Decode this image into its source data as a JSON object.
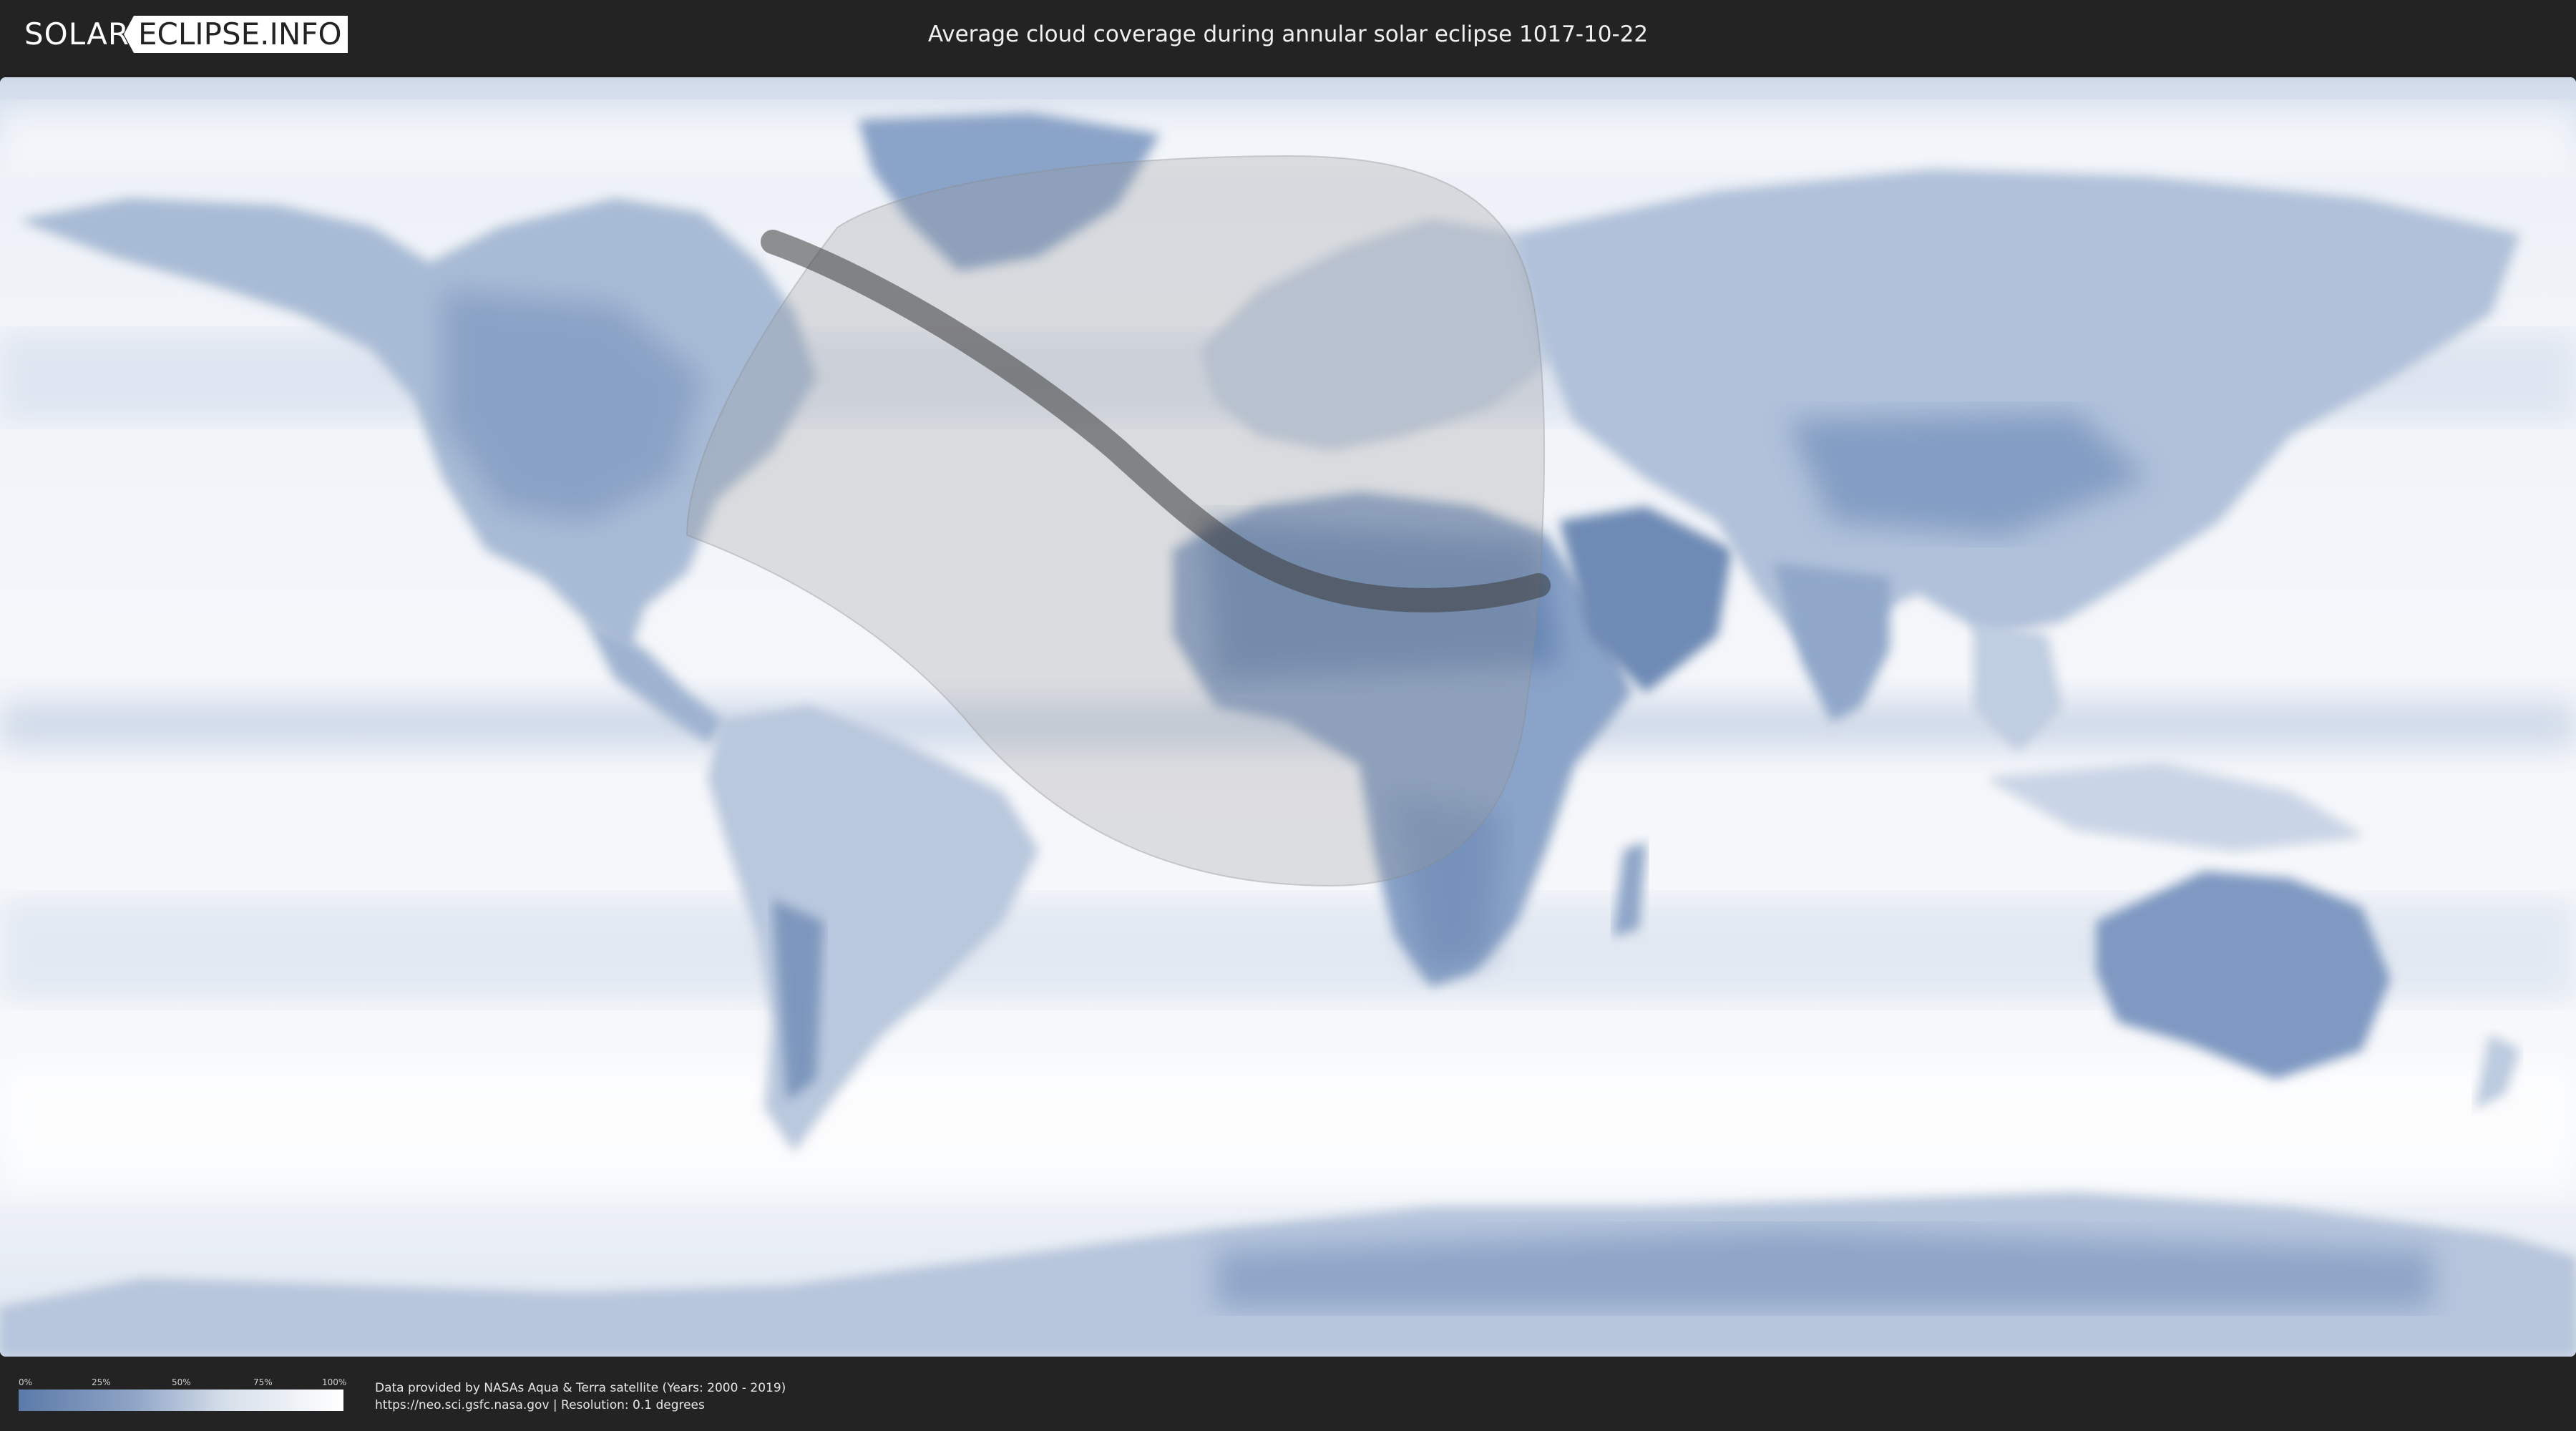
{
  "header": {
    "logo_left": "SOLAR",
    "logo_right": "ECLIPSE.INFO",
    "title": "Average cloud coverage during annular solar eclipse 1017-10-22"
  },
  "map": {
    "description_layer": "cloud-coverage",
    "ocean_color": "#eef2f8",
    "cloud_dense_color": "#ffffff",
    "clear_sky_color": "#5b7aa8",
    "penumbra_color": "#8a8a8a",
    "path_color": "#3a3a3a"
  },
  "legend": {
    "ticks": [
      "0%",
      "25%",
      "50%",
      "75%",
      "100%"
    ],
    "gradient": [
      "#5b7aa8",
      "#8ea4c6",
      "#d9e1ec",
      "#ffffff"
    ]
  },
  "footer": {
    "credit_line1": "Data provided by NASAs Aqua & Terra satellite (Years: 2000 - 2019)",
    "credit_line2": "https://neo.sci.gsfc.nasa.gov | Resolution: 0.1 degrees"
  }
}
